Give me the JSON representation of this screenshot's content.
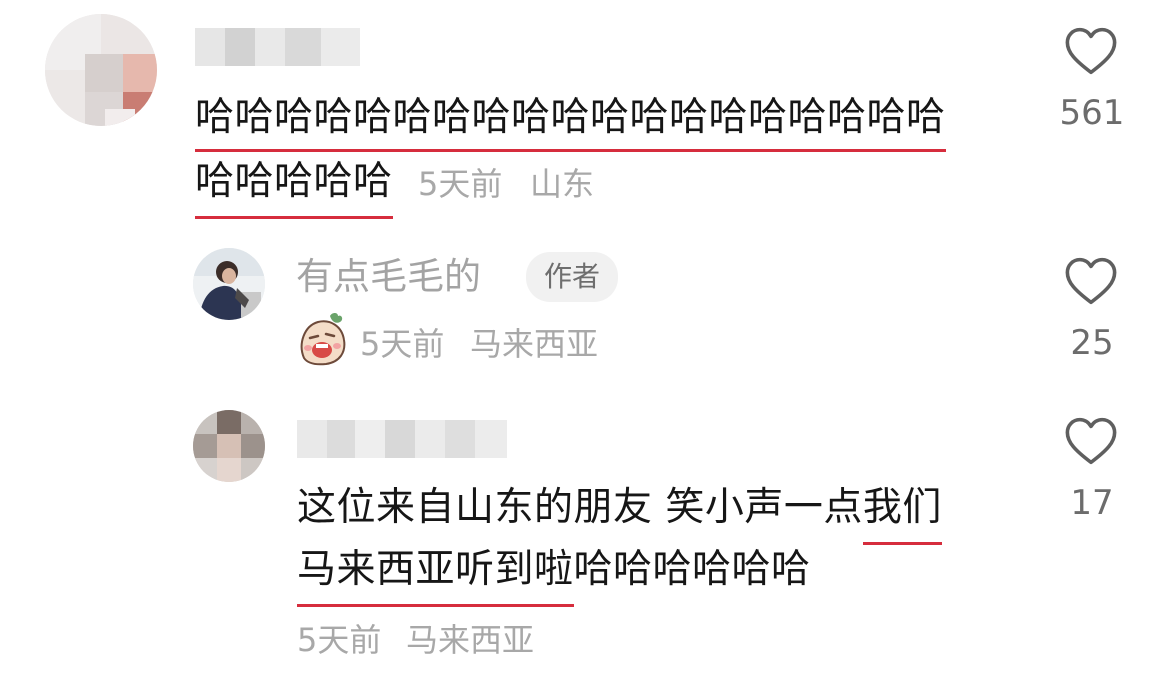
{
  "comments": [
    {
      "username": "",
      "text_lines": [
        "哈哈哈哈哈哈哈哈哈哈哈哈哈哈哈哈哈哈哈",
        "哈哈哈哈哈"
      ],
      "time": "5天前",
      "location": "山东",
      "likes": "561"
    },
    {
      "username": "有点毛毛的",
      "badge": "作者",
      "sticker": "crying-sticker",
      "time": "5天前",
      "location": "马来西亚",
      "likes": "25"
    },
    {
      "username": "",
      "text_line1_a": "这位来自山东的朋友 笑小声一点",
      "text_line1_b": "我们",
      "text_line2_a": "马来西亚听到啦",
      "text_line2_b": "哈哈哈哈哈哈",
      "time": "5天前",
      "location": "马来西亚",
      "likes": "17"
    }
  ],
  "icons": {
    "like": "heart-outline-icon"
  },
  "colors": {
    "underline": "#d62d3d",
    "meta_text": "#a8a8a8",
    "username_text": "#a3a3a3"
  }
}
